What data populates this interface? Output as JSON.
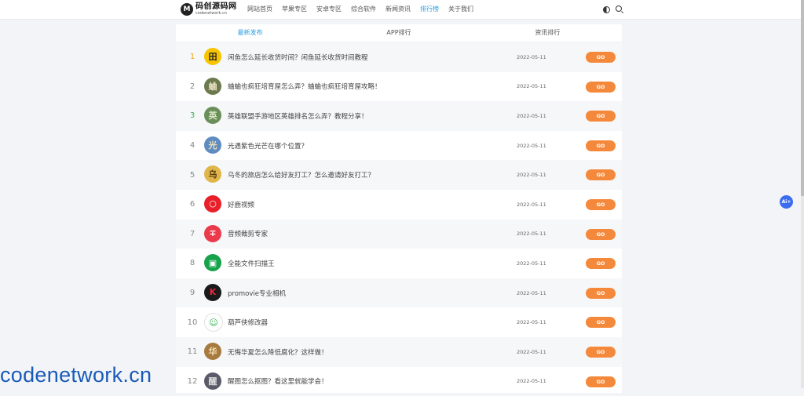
{
  "header": {
    "logo_name": "码创源码网",
    "logo_sub": "codenetwork.cn",
    "nav": [
      "网站首页",
      "苹果专区",
      "安卓专区",
      "综合软件",
      "新闻资讯",
      "排行榜",
      "关于我们"
    ],
    "active_nav": "排行榜"
  },
  "tabs": [
    "最新发布",
    "APP排行",
    "资讯排行"
  ],
  "active_tab": "最新发布",
  "go_label": "GO",
  "ai_label": "Ai+",
  "watermark": "codenetwork.cn",
  "rows": [
    {
      "rank": "1",
      "title": "闲鱼怎么延长收货时间？闲鱼延长收货时间教程",
      "date": "2022-05-11",
      "rank_color": "#f0a400",
      "thumb_bg": "#f7c400",
      "thumb_fg": "#222",
      "thumb_char": "田"
    },
    {
      "rank": "2",
      "title": "蛐蛐也疯狂培育屋怎么弄？蛐蛐也疯狂培育屋攻略！",
      "date": "2022-05-11",
      "rank_color": "#888888",
      "thumb_bg": "#6c7a4e",
      "thumb_fg": "#e8e2c4",
      "thumb_char": "蛐"
    },
    {
      "rank": "3",
      "title": "英雄联盟手游地区英雄排名怎么弄？教程分享！",
      "date": "2022-05-11",
      "rank_color": "#3bb04a",
      "thumb_bg": "#6b8f5a",
      "thumb_fg": "#d9e6c4",
      "thumb_char": "英"
    },
    {
      "rank": "4",
      "title": "光遇紫色光芒在哪个位置？",
      "date": "2022-05-11",
      "rank_color": "#888888",
      "thumb_bg": "#5e8cc0",
      "thumb_fg": "#f0e1b8",
      "thumb_char": "光"
    },
    {
      "rank": "5",
      "title": "乌冬的旅店怎么给好友打工？怎么邀请好友打工？",
      "date": "2022-05-11",
      "rank_color": "#888888",
      "thumb_bg": "#e0b64a",
      "thumb_fg": "#5a3b12",
      "thumb_char": "乌"
    },
    {
      "rank": "6",
      "title": "好鹿视频",
      "date": "2022-05-11",
      "rank_color": "#888888",
      "thumb_bg": "#e8202a",
      "thumb_fg": "#fff",
      "thumb_char": "○"
    },
    {
      "rank": "7",
      "title": "音频裁剪专家",
      "date": "2022-05-11",
      "rank_color": "#888888",
      "thumb_bg": "#ea3a4c",
      "thumb_fg": "#fff",
      "thumb_char": "∓"
    },
    {
      "rank": "8",
      "title": "全能文件扫描王",
      "date": "2022-05-11",
      "rank_color": "#888888",
      "thumb_bg": "#16a34a",
      "thumb_fg": "#fff",
      "thumb_char": "▣"
    },
    {
      "rank": "9",
      "title": "promovie专业相机",
      "date": "2022-05-11",
      "rank_color": "#888888",
      "thumb_bg": "#1a1a1a",
      "thumb_fg": "#e8273c",
      "thumb_char": "K"
    },
    {
      "rank": "10",
      "title": "葫芦侠修改器",
      "date": "2022-05-11",
      "rank_color": "#888888",
      "thumb_bg": "#ffffff",
      "thumb_fg": "#2bb24c",
      "thumb_char": "☺"
    },
    {
      "rank": "11",
      "title": "无悔华夏怎么降低腐化？这样做！",
      "date": "2022-05-11",
      "rank_color": "#888888",
      "thumb_bg": "#a77a3f",
      "thumb_fg": "#f4dfb4",
      "thumb_char": "华"
    },
    {
      "rank": "12",
      "title": "醒图怎么抠图？看这里就能学会！",
      "date": "2022-05-11",
      "rank_color": "#888888",
      "thumb_bg": "#5a5a6a",
      "thumb_fg": "#e0e0e0",
      "thumb_char": "醒"
    }
  ]
}
